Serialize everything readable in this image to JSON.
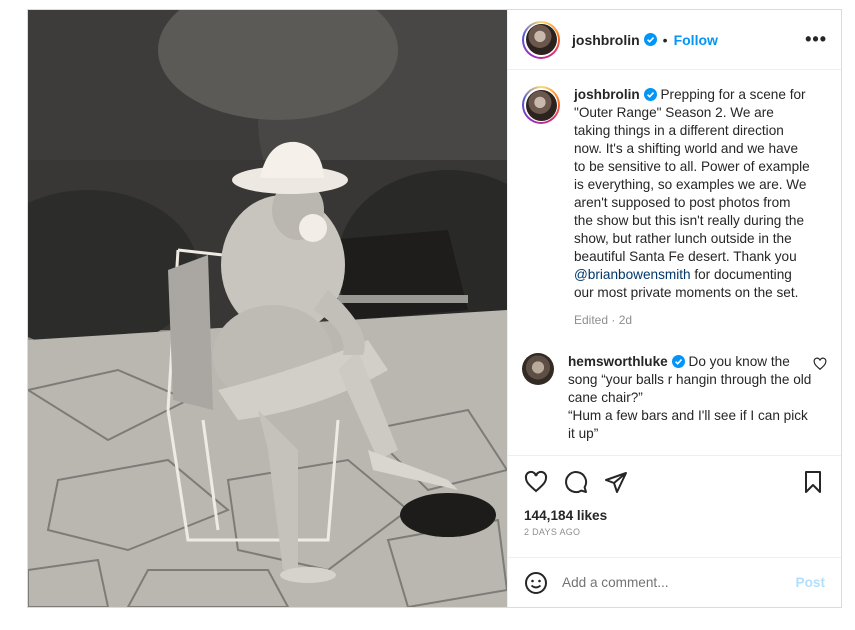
{
  "header": {
    "username": "joshbrolin",
    "separator": "•",
    "follow_label": "Follow",
    "more_label": "•••"
  },
  "caption": {
    "username": "joshbrolin",
    "text_before": "Prepping for a scene for \"Outer Range\" Season 2. We are taking things in a different direction now. It's a shifting world and we have to be sensitive to all. Power of example is everything, so examples we are. We aren't supposed to post photos from the show but this isn't really during the show, but rather lunch outside in the beautiful Santa Fe desert. Thank you ",
    "mention": "@brianbowensmith",
    "text_after": " for documenting our most private moments on the set.",
    "meta": "Edited · 2d"
  },
  "reply": {
    "username": "hemsworthluke",
    "line1": "Do you know the song “your balls r hangin through the old cane chair?”",
    "line2": "“Hum a few bars and I'll see if I can pick it up”"
  },
  "stats": {
    "likes": "144,184 likes",
    "date": "2 DAYS AGO"
  },
  "add_comment": {
    "placeholder": "Add a comment...",
    "post_label": "Post"
  },
  "icons": {
    "verified": "verified-badge-icon",
    "like": "heart-icon",
    "comment": "comment-icon",
    "share": "share-icon",
    "save": "bookmark-icon",
    "emoji": "emoji-icon",
    "more": "more-options-icon"
  },
  "colors": {
    "accent": "#0095f6",
    "verified": "#0095f6",
    "post_disabled": "#b2dffc",
    "mention": "#00376b",
    "muted": "#8e8e8e"
  }
}
